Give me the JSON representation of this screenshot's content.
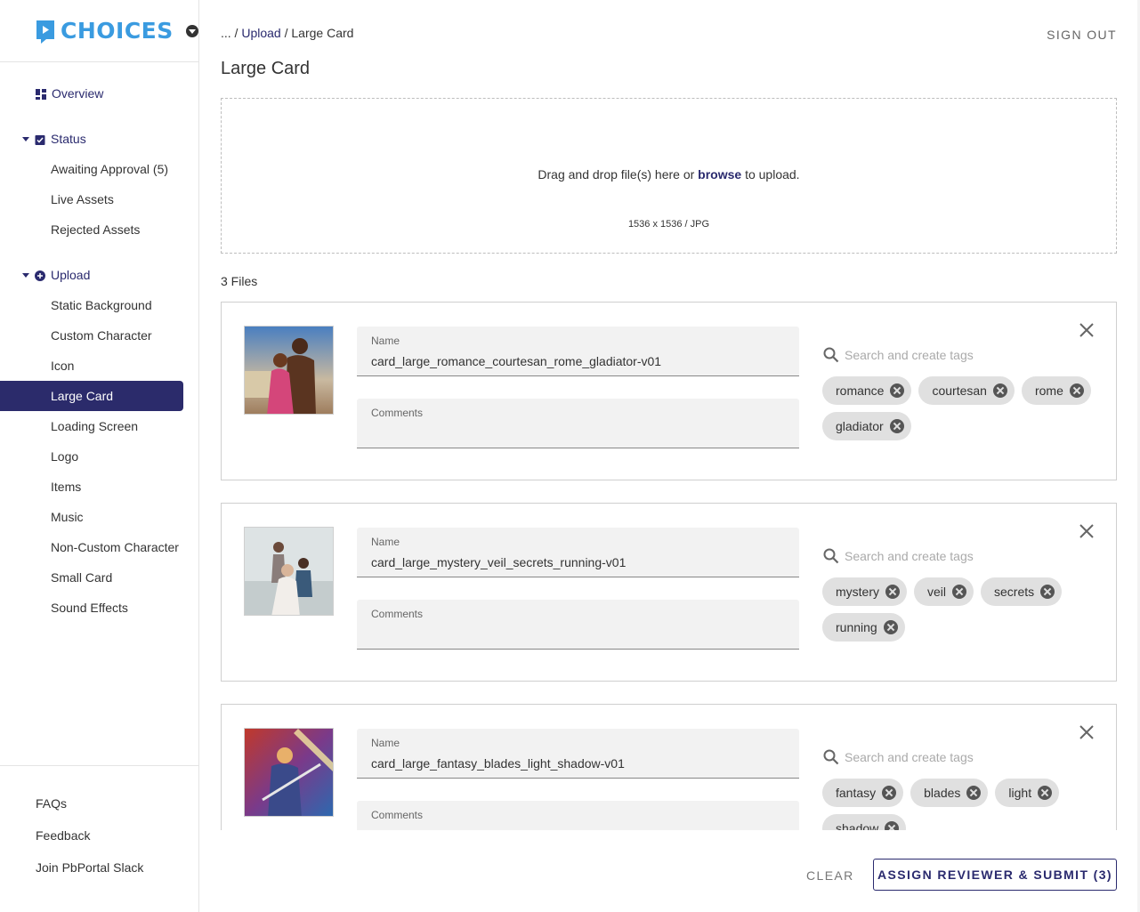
{
  "brand": {
    "name": "CHOICES",
    "color": "#3a9be0"
  },
  "sidebar": {
    "overview": "Overview",
    "status": {
      "label": "Status",
      "items": [
        "Awaiting Approval (5)",
        "Live Assets",
        "Rejected Assets"
      ]
    },
    "upload": {
      "label": "Upload",
      "items": [
        "Static Background",
        "Custom Character",
        "Icon",
        "Large Card",
        "Loading Screen",
        "Logo",
        "Items",
        "Music",
        "Non-Custom Character",
        "Small Card",
        "Sound Effects"
      ],
      "active": "Large Card"
    },
    "footer": [
      "FAQs",
      "Feedback",
      "Join PbPortal Slack"
    ]
  },
  "header": {
    "breadcrumb_prefix": "... /",
    "breadcrumb_link": "Upload",
    "breadcrumb_sep": "/",
    "breadcrumb_current": "Large Card",
    "sign_out": "SIGN OUT",
    "title": "Large Card"
  },
  "dropzone": {
    "text_before": "Drag and drop file(s) here or",
    "browse": "browse",
    "text_after": "to upload.",
    "spec": "1536 x 1536 / JPG"
  },
  "files_count": "3 Files",
  "labels": {
    "name": "Name",
    "comments": "Comments",
    "tag_placeholder": "Search and create tags"
  },
  "files": [
    {
      "name": "card_large_romance_courtesan_rome_gladiator-v01",
      "tags": [
        "romance",
        "courtesan",
        "rome",
        "gladiator"
      ]
    },
    {
      "name": "card_large_mystery_veil_secrets_running-v01",
      "tags": [
        "mystery",
        "veil",
        "secrets",
        "running"
      ]
    },
    {
      "name": "card_large_fantasy_blades_light_shadow-v01",
      "tags": [
        "fantasy",
        "blades",
        "light",
        "shadow"
      ]
    }
  ],
  "actions": {
    "clear": "CLEAR",
    "submit": "ASSIGN REVIEWER & SUBMIT (3)"
  },
  "colors": {
    "navy": "#2a2a6e",
    "active_bg": "#2b2b6b"
  }
}
